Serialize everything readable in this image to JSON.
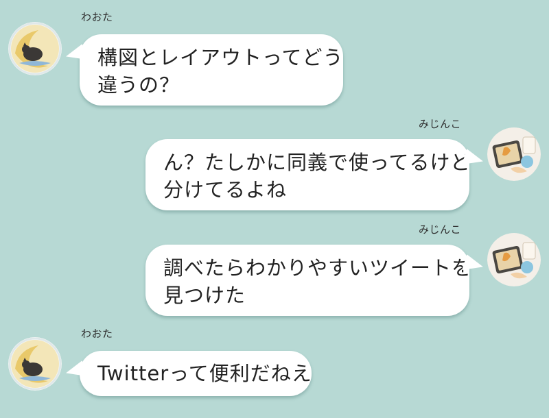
{
  "colors": {
    "background": "#b7d9d4",
    "bubble": "#ffffff",
    "text": "#222222"
  },
  "messages": [
    {
      "sender": "わおた",
      "side": "left",
      "avatar_icon": "moon-cat-avatar-icon",
      "lines": [
        "構図とレイアウトってどう",
        "違うの？"
      ]
    },
    {
      "sender": "みじんこ",
      "side": "right",
      "avatar_icon": "drawing-desk-avatar-icon",
      "lines": [
        "ん？たしかに同義で使ってるけど",
        "分けてるよね"
      ]
    },
    {
      "sender": "みじんこ",
      "side": "right",
      "avatar_icon": "drawing-desk-avatar-icon",
      "lines": [
        "調べたらわかりやすいツイートを",
        "見つけた"
      ]
    },
    {
      "sender": "わおた",
      "side": "left",
      "avatar_icon": "moon-cat-avatar-icon",
      "lines": [
        "Twitterって便利だねえ"
      ]
    }
  ]
}
